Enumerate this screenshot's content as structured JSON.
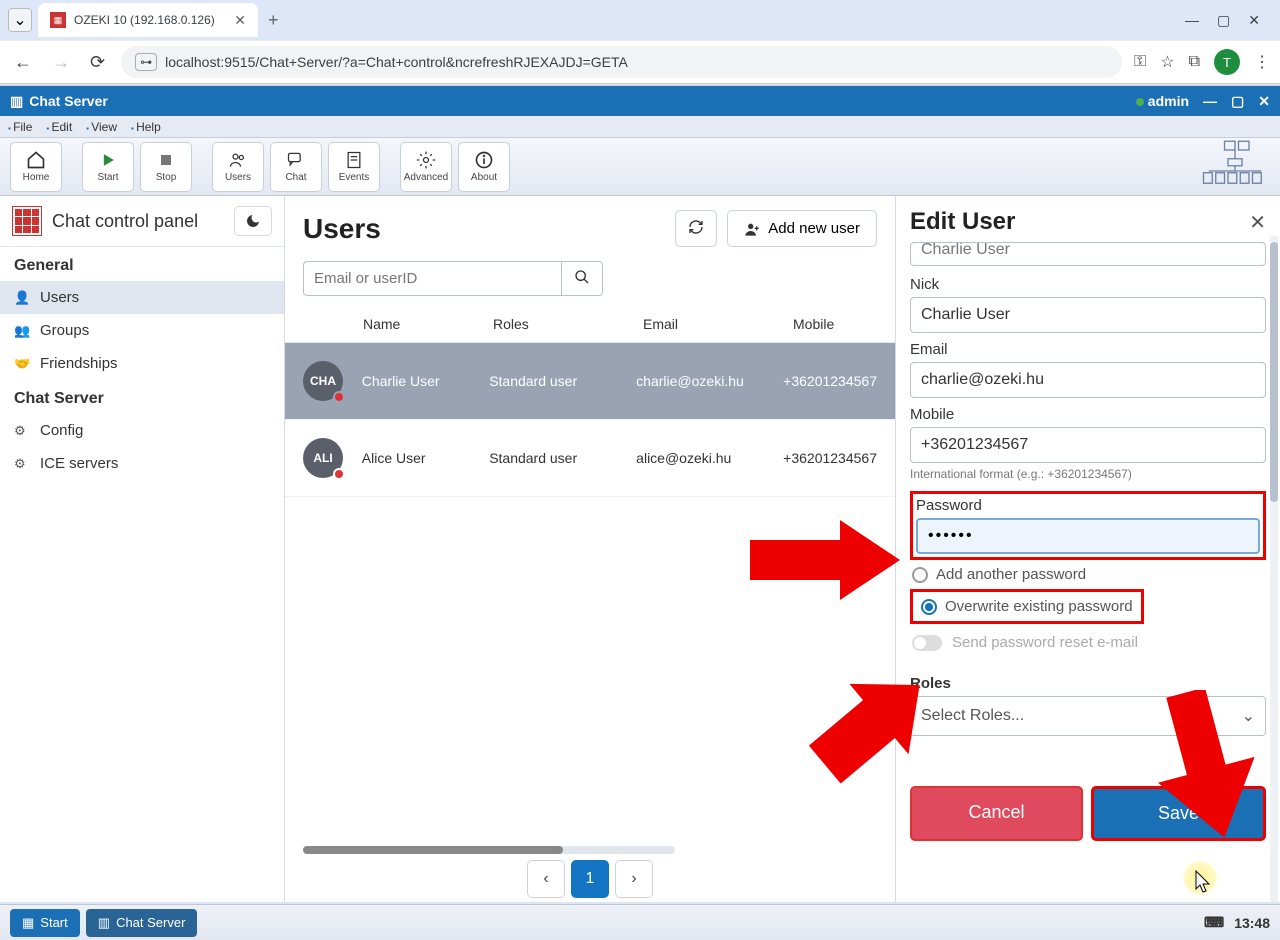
{
  "browser": {
    "tab_title": "OZEKI 10 (192.168.0.126)",
    "url": "localhost:9515/Chat+Server/?a=Chat+control&ncrefreshRJEXAJDJ=GETA",
    "profile_letter": "T"
  },
  "app": {
    "title": "Chat Server",
    "user": "admin",
    "menu": [
      "File",
      "Edit",
      "View",
      "Help"
    ],
    "tools": [
      "Home",
      "Start",
      "Stop",
      "Users",
      "Chat",
      "Events",
      "Advanced",
      "About"
    ]
  },
  "sidebar": {
    "title": "Chat control panel",
    "sections": [
      {
        "title": "General",
        "items": [
          "Users",
          "Groups",
          "Friendships"
        ],
        "active": 0
      },
      {
        "title": "Chat Server",
        "items": [
          "Config",
          "ICE servers"
        ]
      }
    ]
  },
  "center": {
    "title": "Users",
    "add_label": "Add new user",
    "search_placeholder": "Email or userID",
    "cols": [
      "Name",
      "Roles",
      "Email",
      "Mobile"
    ],
    "rows": [
      {
        "initials": "CHA",
        "name": "Charlie User",
        "role": "Standard user",
        "email": "charlie@ozeki.hu",
        "mobile": "+36201234567",
        "selected": true
      },
      {
        "initials": "ALI",
        "name": "Alice User",
        "role": "Standard user",
        "email": "alice@ozeki.hu",
        "mobile": "+36201234567",
        "selected": false
      }
    ],
    "page": "1"
  },
  "edit": {
    "title": "Edit User",
    "topcut_value": "Charlie User",
    "nick_label": "Nick",
    "nick_value": "Charlie User",
    "email_label": "Email",
    "email_value": "charlie@ozeki.hu",
    "mobile_label": "Mobile",
    "mobile_value": "+36201234567",
    "mobile_hint": "International format (e.g.: +36201234567)",
    "password_label": "Password",
    "password_value": "••••••",
    "radio_add": "Add another password",
    "radio_overwrite": "Overwrite existing password",
    "toggle_label": "Send password reset e-mail",
    "roles_label": "Roles",
    "roles_placeholder": "Select Roles...",
    "cancel": "Cancel",
    "save": "Save"
  },
  "taskbar": {
    "start": "Start",
    "app": "Chat Server",
    "clock": "13:48"
  }
}
